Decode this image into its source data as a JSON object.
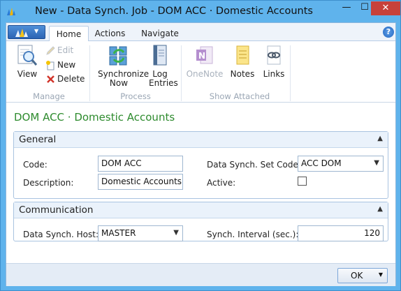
{
  "window": {
    "title": "New - Data Synch. Job - DOM ACC · Domestic Accounts",
    "minimize": "—",
    "maximize": "☐",
    "close": "✕"
  },
  "ribbon": {
    "tabs": [
      {
        "label": "Home",
        "active": true
      },
      {
        "label": "Actions",
        "active": false
      },
      {
        "label": "Navigate",
        "active": false
      }
    ],
    "help": "?",
    "groups": {
      "manage": {
        "label": "Manage",
        "view": "View",
        "edit": "Edit",
        "new": "New",
        "delete": "Delete"
      },
      "process": {
        "label": "Process",
        "synchronize_now": "Synchronize Now",
        "log_entries": "Log Entries"
      },
      "show_attached": {
        "label": "Show Attached",
        "onenote": "OneNote",
        "notes": "Notes",
        "links": "Links"
      }
    }
  },
  "page": {
    "title": "DOM ACC · Domestic Accounts"
  },
  "general": {
    "header": "General",
    "code_label": "Code:",
    "code_value": "DOM ACC",
    "description_label": "Description:",
    "description_value": "Domestic Accounts",
    "set_code_label": "Data Synch. Set Code:",
    "set_code_value": "ACC DOM",
    "active_label": "Active:",
    "active_checked": false
  },
  "communication": {
    "header": "Communication",
    "host_label": "Data Synch. Host:",
    "host_value": "MASTER",
    "interval_label": "Synch. Interval (sec.):",
    "interval_value": "120"
  },
  "footer": {
    "ok_label": "OK"
  },
  "colors": {
    "titlebar": "#5fb3ec",
    "page_title": "#2e8b2e",
    "close_button": "#c7413a"
  }
}
